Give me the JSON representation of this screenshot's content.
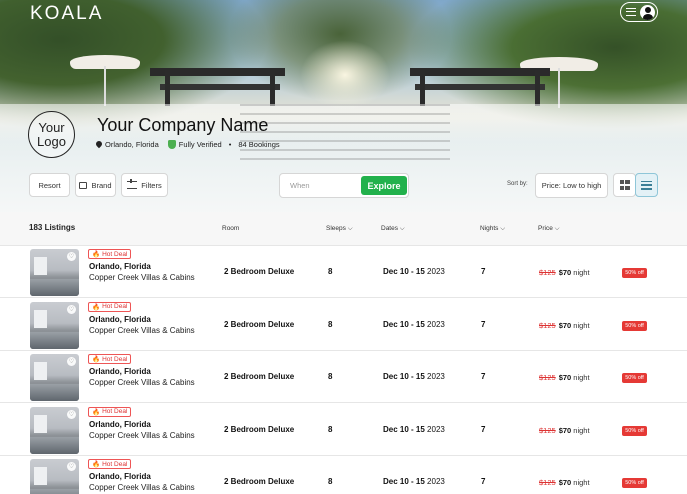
{
  "header": {
    "brand": "KOALA",
    "logo_line1": "Your",
    "logo_line2": "Logo",
    "company_name": "Your Company Name",
    "location": "Orlando, Florida",
    "verified": "Fully Verified",
    "bullet": "•",
    "bookings": "84 Bookings"
  },
  "filters": {
    "resort": "Resort",
    "brand": "Brand",
    "filters": "Filters",
    "when_placeholder": "When",
    "explore": "Explore",
    "sort_label": "Sort by:",
    "sort_value": "Price: Low to high"
  },
  "table": {
    "count": "183 Listings",
    "col_room": "Room",
    "col_sleeps": "Sleeps",
    "col_dates": "Dates",
    "col_nights": "Nights",
    "col_price": "Price",
    "rows": [
      {
        "deal": "Hot Deal",
        "location": "Orlando, Florida",
        "resort": "Copper Creek Villas & Cabins",
        "room": "2 Bedroom Deluxe",
        "sleeps": "8",
        "dates_bold": "Dec 10 - 15",
        "year": "2023",
        "nights": "7",
        "old_price": "$125",
        "new_price": "$70",
        "unit": "night",
        "discount": "50% off"
      },
      {
        "deal": "Hot Deal",
        "location": "Orlando, Florida",
        "resort": "Copper Creek Villas & Cabins",
        "room": "2 Bedroom Deluxe",
        "sleeps": "8",
        "dates_bold": "Dec 10 - 15",
        "year": "2023",
        "nights": "7",
        "old_price": "$125",
        "new_price": "$70",
        "unit": "night",
        "discount": "50% off"
      },
      {
        "deal": "Hot Deal",
        "location": "Orlando, Florida",
        "resort": "Copper Creek Villas & Cabins",
        "room": "2 Bedroom Deluxe",
        "sleeps": "8",
        "dates_bold": "Dec 10 - 15",
        "year": "2023",
        "nights": "7",
        "old_price": "$125",
        "new_price": "$70",
        "unit": "night",
        "discount": "50% off"
      },
      {
        "deal": "Hot Deal",
        "location": "Orlando, Florida",
        "resort": "Copper Creek Villas & Cabins",
        "room": "2 Bedroom Deluxe",
        "sleeps": "8",
        "dates_bold": "Dec 10 - 15",
        "year": "2023",
        "nights": "7",
        "old_price": "$125",
        "new_price": "$70",
        "unit": "night",
        "discount": "50% off"
      },
      {
        "deal": "Hot Deal",
        "location": "Orlando, Florida",
        "resort": "Copper Creek Villas & Cabins",
        "room": "2 Bedroom Deluxe",
        "sleeps": "8",
        "dates_bold": "Dec 10 - 15",
        "year": "2023",
        "nights": "7",
        "old_price": "$125",
        "new_price": "$70",
        "unit": "night",
        "discount": "50% off"
      }
    ]
  },
  "icons": {
    "hamburger": "menu-icon",
    "user": "user-icon",
    "pin": "location-pin-icon",
    "shield": "verified-shield-icon",
    "brand": "tag-icon",
    "filter": "filter-icon",
    "grid": "grid-view-icon",
    "list": "list-view-icon",
    "heart": "heart-icon",
    "fire": "fire-icon",
    "chevron": "chevron-down-icon"
  },
  "colors": {
    "accent_green": "#22b14c",
    "deal_red": "#e53935",
    "list_active": "#e3f1f6"
  }
}
